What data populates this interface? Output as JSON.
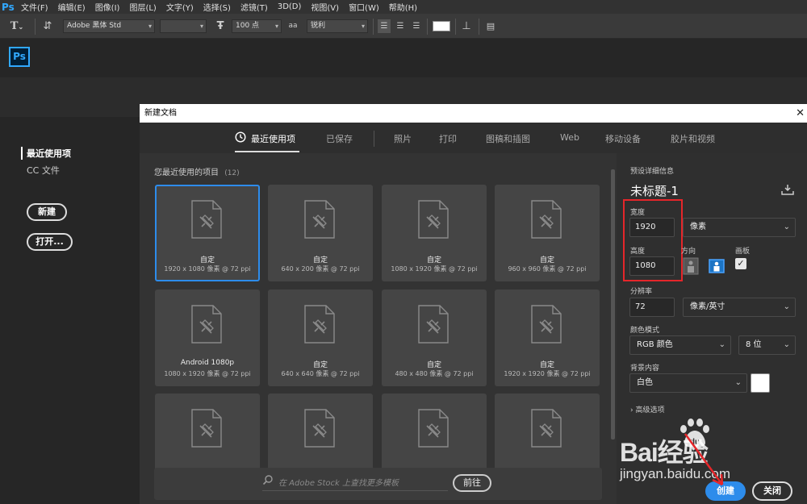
{
  "menubar": {
    "app_logo": "Ps",
    "items": [
      "文件(F)",
      "编辑(E)",
      "图像(I)",
      "图层(L)",
      "文字(Y)",
      "选择(S)",
      "滤镜(T)",
      "3D(D)",
      "视图(V)",
      "窗口(W)",
      "帮助(H)"
    ]
  },
  "options_bar": {
    "font_family": "Adobe 黑体 Std",
    "font_style": "",
    "font_size": "100 点",
    "aa_label": "aa",
    "antialias": "锐利",
    "text_color": "#ffffff"
  },
  "home": {
    "app_logo": "Ps",
    "nav_recent": "最近使用项",
    "nav_cc": "CC 文件",
    "new_button": "新建",
    "open_button": "打开..."
  },
  "dialog": {
    "title": "新建文档",
    "close_glyph": "✕",
    "tabs": [
      {
        "label": "最近使用项"
      },
      {
        "label": "已保存"
      },
      {
        "label": "照片"
      },
      {
        "label": "打印"
      },
      {
        "label": "图稿和插图"
      },
      {
        "label": "Web"
      },
      {
        "label": "移动设备"
      },
      {
        "label": "胶片和视频"
      }
    ],
    "presets_heading": "您最近使用的项目",
    "presets_count": "(12)",
    "presets": [
      {
        "name": "自定",
        "size": "1920 x 1080 像素 @ 72 ppi",
        "selected": true
      },
      {
        "name": "自定",
        "size": "640 x 200 像素 @ 72 ppi",
        "selected": false
      },
      {
        "name": "自定",
        "size": "1080 x 1920 像素 @ 72 ppi",
        "selected": false
      },
      {
        "name": "自定",
        "size": "960 x 960 像素 @ 72 ppi",
        "selected": false
      },
      {
        "name": "Android 1080p",
        "size": "1080 x 1920 像素 @ 72 ppi",
        "selected": false
      },
      {
        "name": "自定",
        "size": "640 x 640 像素 @ 72 ppi",
        "selected": false
      },
      {
        "name": "自定",
        "size": "480 x 480 像素 @ 72 ppi",
        "selected": false
      },
      {
        "name": "自定",
        "size": "1920 x 1920 像素 @ 72 ppi",
        "selected": false
      },
      {
        "name": "",
        "size": "",
        "selected": false
      },
      {
        "name": "",
        "size": "",
        "selected": false
      },
      {
        "name": "",
        "size": "",
        "selected": false
      },
      {
        "name": "",
        "size": "",
        "selected": false
      }
    ],
    "stock_placeholder": "在 Adobe Stock 上查找更多模板",
    "go_button": "前往",
    "details": {
      "heading": "预设详细信息",
      "doc_name": "未标题-1",
      "width_label": "宽度",
      "width_value": "1920",
      "unit": "像素",
      "height_label": "高度",
      "height_value": "1080",
      "orientation_label": "方向",
      "artboard_label": "画板",
      "artboard_checked": "✓",
      "resolution_label": "分辨率",
      "resolution_value": "72",
      "resolution_unit": "像素/英寸",
      "color_mode_label": "颜色模式",
      "color_mode": "RGB 颜色",
      "bit_depth": "8 位",
      "background_label": "背景内容",
      "background": "白色",
      "background_color": "#ffffff",
      "advanced": "高级选项",
      "create_button": "创建",
      "close_button": "关闭"
    }
  },
  "watermark": {
    "brand": "Bai经验",
    "url": "jingyan.baidu.com"
  },
  "colors": {
    "accent": "#2d8ceb",
    "highlight": "#e5262a",
    "ps_blue": "#31a8ff"
  }
}
